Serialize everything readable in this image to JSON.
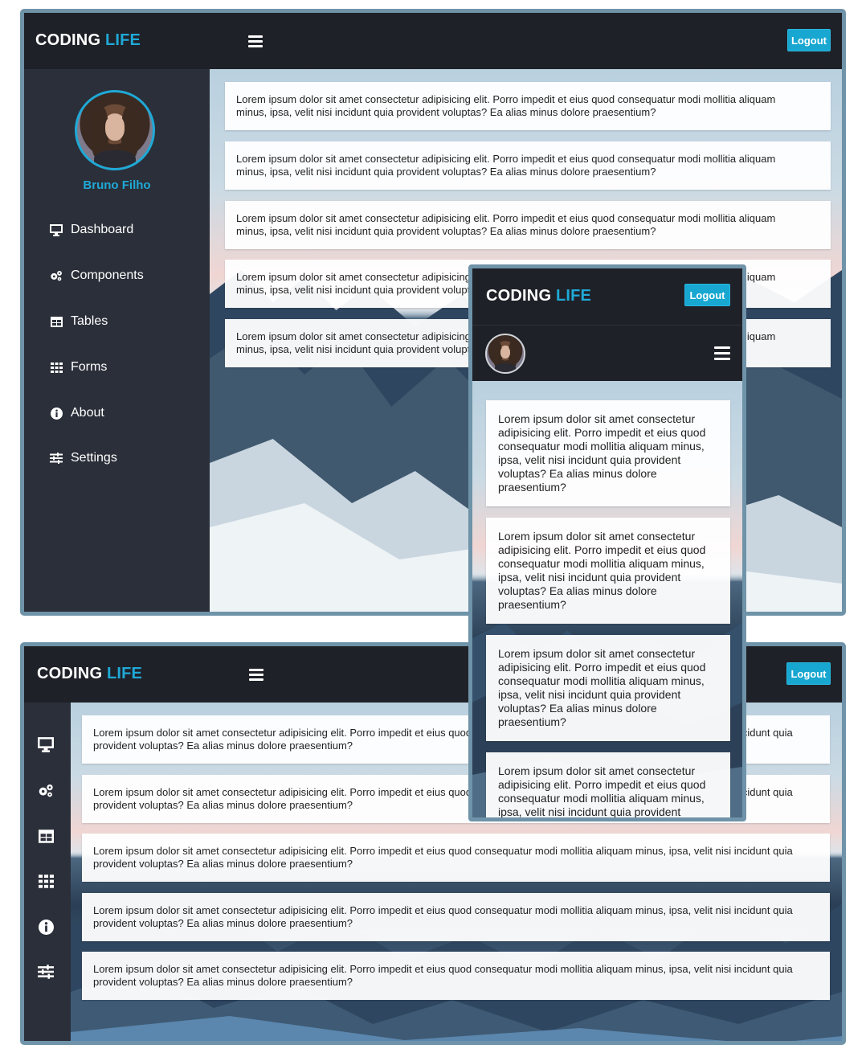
{
  "brand": {
    "first": "CODING",
    "accent": "LIFE"
  },
  "header": {
    "logout_label": "Logout"
  },
  "user": {
    "name": "Bruno Filho"
  },
  "sidebar": {
    "items": [
      {
        "label": "Dashboard",
        "icon": "monitor-icon"
      },
      {
        "label": "Components",
        "icon": "cogs-icon"
      },
      {
        "label": "Tables",
        "icon": "table-icon"
      },
      {
        "label": "Forms",
        "icon": "grid-icon"
      },
      {
        "label": "About",
        "icon": "info-icon"
      },
      {
        "label": "Settings",
        "icon": "sliders-icon"
      }
    ]
  },
  "content": {
    "card_text": "Lorem ipsum dolor sit amet consectetur adipisicing elit. Porro impedit et eius quod consequatur modi mollitia aliquam minus, ipsa, velit nisi incidunt quia provident voluptas? Ea alias minus dolore praesentium?"
  },
  "colors": {
    "accent": "#1fa9d6",
    "topbar": "#1f2128",
    "sidebar": "#2b2f39",
    "frame_border": "#6f93a8"
  }
}
